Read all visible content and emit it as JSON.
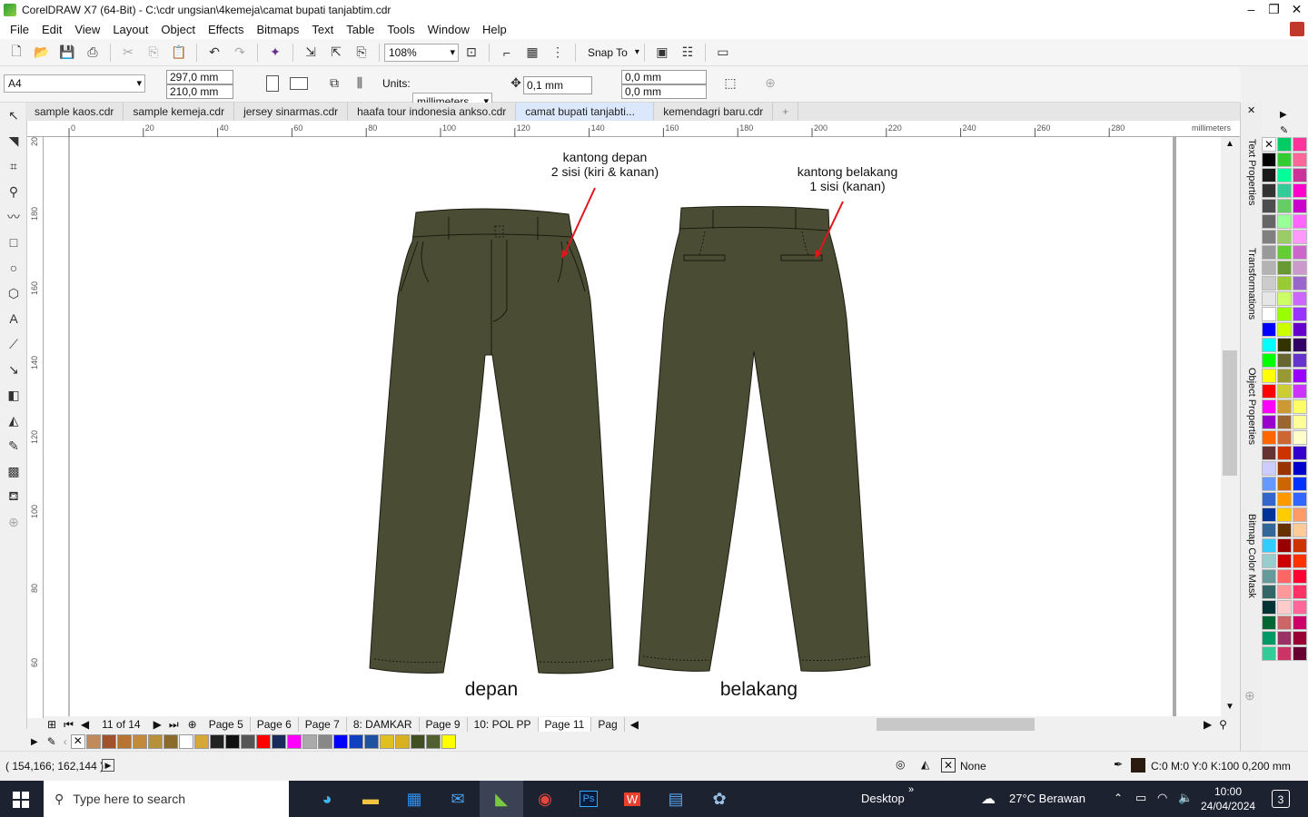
{
  "window": {
    "title": "CorelDRAW X7 (64-Bit) - C:\\cdr ungsian\\4kemeja\\camat bupati tanjabtim.cdr"
  },
  "menu": [
    "File",
    "Edit",
    "View",
    "Layout",
    "Object",
    "Effects",
    "Bitmaps",
    "Text",
    "Table",
    "Tools",
    "Window",
    "Help"
  ],
  "toolbar": {
    "zoom": "108%",
    "snap_to": "Snap To"
  },
  "property_bar": {
    "page_size": "A4",
    "width": "297,0 mm",
    "height": "210,0 mm",
    "units_label": "Units:",
    "units": "millimeters",
    "nudge": "0,1 mm",
    "dup_x": "0,0 mm",
    "dup_y": "0,0 mm"
  },
  "doc_tabs": [
    "sample kaos.cdr",
    "sample kemeja.cdr",
    "jersey sinarmas.cdr",
    "haafa tour indonesia ankso.cdr",
    "camat bupati tanjabti...",
    "kemendagri baru.cdr"
  ],
  "active_tab": 4,
  "ruler": {
    "h_ticks": [
      "0",
      "20",
      "40",
      "60",
      "80",
      "100",
      "120",
      "140",
      "160",
      "180",
      "200",
      "220",
      "240",
      "260",
      "280"
    ],
    "units": "millimeters",
    "v_ticks": [
      "200",
      "180",
      "160",
      "140",
      "120",
      "100",
      "80",
      "60"
    ]
  },
  "canvas": {
    "note_front": [
      "kantong depan",
      "2 sisi (kiri & kanan)"
    ],
    "note_back": [
      "kantong belakang",
      "1 sisi (kanan)"
    ],
    "label_front": "depan",
    "label_back": "belakang",
    "pants_color": "#4a4d33"
  },
  "page_nav": {
    "counter": "11 of 14",
    "pages": [
      "Page 5",
      "Page 6",
      "Page 7",
      "8: DAMKAR",
      "Page 9",
      "10: POL PP",
      "Page 11",
      "Pag"
    ],
    "active": 6
  },
  "doc_palette": [
    "#c08a5a",
    "#a0522d",
    "#b87333",
    "#c48a3c",
    "#b8903c",
    "#8b6a2a",
    "#ffffff",
    "#d4a737",
    "#222222",
    "#111111",
    "#555555",
    "#ff0000",
    "#1a2a5a",
    "#ff00ff",
    "#aaaaaa",
    "#888888",
    "#0000ff",
    "#1040c0",
    "#2050a0",
    "#e0c020",
    "#d8b020",
    "#405020",
    "#506030",
    "#ffff00"
  ],
  "status": {
    "coords": "( 154,166; 162,144 )",
    "fill": "None",
    "outline": "C:0 M:0 Y:0 K:100  0,200 mm"
  },
  "dockers": [
    "Text Properties",
    "Transformations",
    "Object Properties",
    "Bitmap Color Mask"
  ],
  "palette_cols": [
    [
      "#ffffff",
      "#000000",
      "#1a1a1a",
      "#333333",
      "#4d4d4d",
      "#666666",
      "#808080",
      "#999999",
      "#b3b3b3",
      "#cccccc",
      "#e6e6e6",
      "#ffffff",
      "#0000ff",
      "#00ffff",
      "#00ff00",
      "#ffff00",
      "#ff0000",
      "#ff00ff",
      "#9900cc",
      "#ff6600",
      "#663333",
      "#ccccff",
      "#6699ff",
      "#3366cc",
      "#003399",
      "#336699",
      "#33ccff",
      "#99cccc",
      "#669999",
      "#336666",
      "#003333",
      "#006633",
      "#009966",
      "#33cc99"
    ],
    [
      "#00cc66",
      "#33cc33",
      "#00ff99",
      "#33cc99",
      "#66cc66",
      "#99ff99",
      "#99cc66",
      "#66cc33",
      "#669933",
      "#99cc33",
      "#ccff66",
      "#99ff00",
      "#ccff00",
      "#333300",
      "#666633",
      "#999933",
      "#cccc33",
      "#cc9933",
      "#996633",
      "#cc6633",
      "#cc3300",
      "#993300",
      "#cc6600",
      "#ff9900",
      "#ffcc00",
      "#663300",
      "#990000",
      "#cc0000",
      "#ff6666",
      "#ff9999",
      "#ffcccc",
      "#cc6666",
      "#993366",
      "#cc3366"
    ],
    [
      "#ff3399",
      "#ff6699",
      "#cc3399",
      "#ff00cc",
      "#cc00cc",
      "#ff66ff",
      "#ff99ff",
      "#cc66cc",
      "#cc99cc",
      "#9966cc",
      "#cc66ff",
      "#9933ff",
      "#6600cc",
      "#330066",
      "#6633cc",
      "#9900ff",
      "#cc33ff",
      "#ffff66",
      "#ffff99",
      "#ffffcc",
      "#3300cc",
      "#0000cc",
      "#0033ff",
      "#3366ff",
      "#ff9966",
      "#ffcc99",
      "#cc3300",
      "#ff3300",
      "#ff0033",
      "#ff3366",
      "#ff6699",
      "#cc0066",
      "#990033",
      "#660033"
    ]
  ],
  "taskbar": {
    "search": "Type here to search",
    "desktop": "Desktop",
    "weather": "27°C  Berawan",
    "time": "10:00",
    "date": "24/04/2024",
    "notif": "3"
  }
}
